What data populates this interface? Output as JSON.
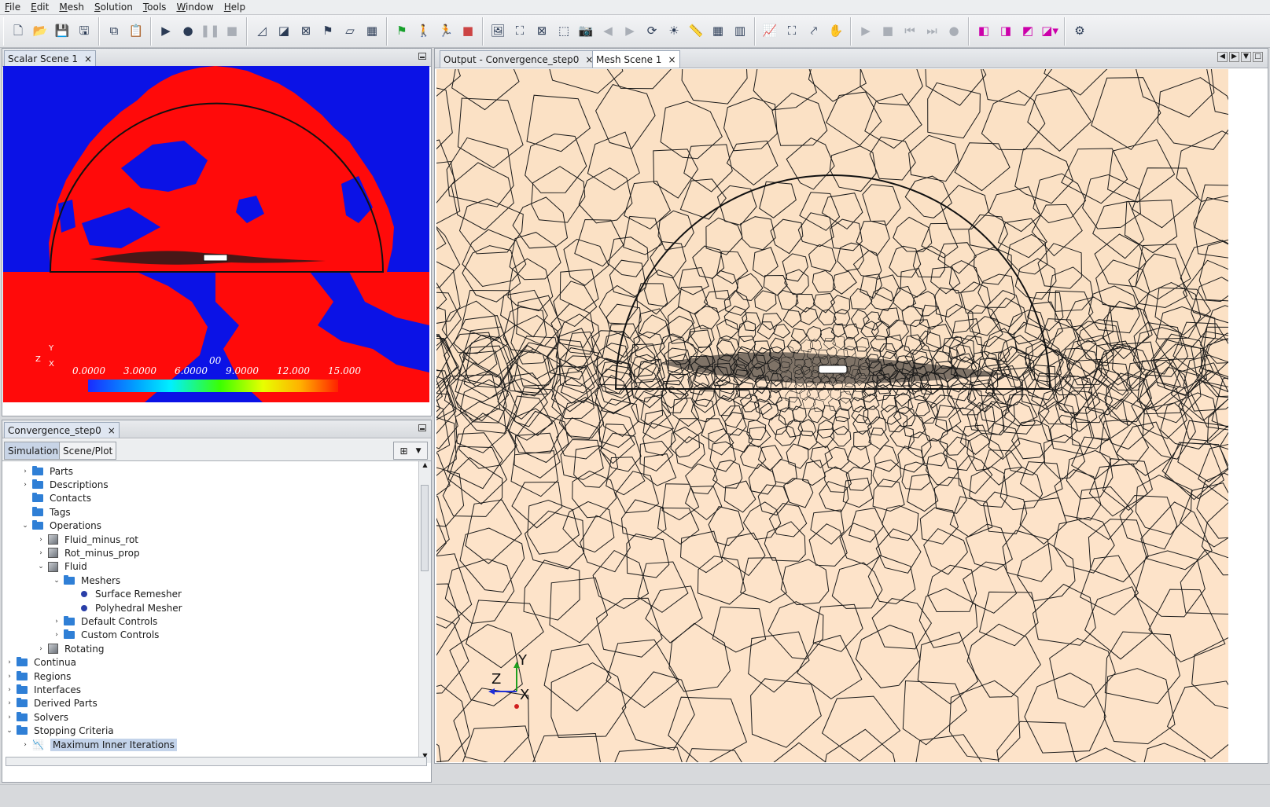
{
  "menu": [
    "File",
    "Edit",
    "Mesh",
    "Solution",
    "Tools",
    "Window",
    "Help"
  ],
  "scalar_panel": {
    "tab_label": "Scalar Scene 1",
    "close": "×"
  },
  "colorbar": {
    "unit_label": "00",
    "ticks": [
      "0.0000",
      "3.0000",
      "6.0000",
      "9.0000",
      "12.000",
      "15.000"
    ]
  },
  "scalar_axes": {
    "y": "Y",
    "z": "Z",
    "x": "X"
  },
  "sim_panel": {
    "tab_label": "Convergence_step0",
    "close": "×",
    "subtabs": [
      "Simulation",
      "Scene/Plot"
    ]
  },
  "tree": [
    {
      "label": "Parts",
      "icon": "folder",
      "depth": 1
    },
    {
      "label": "Descriptions",
      "icon": "folder",
      "depth": 1
    },
    {
      "label": "Contacts",
      "icon": "folder",
      "depth": 1
    },
    {
      "label": "Tags",
      "icon": "folder",
      "depth": 1
    },
    {
      "label": "Operations",
      "icon": "folder",
      "depth": 1
    },
    {
      "label": "Fluid_minus_rot",
      "icon": "cube",
      "depth": 2
    },
    {
      "label": "Rot_minus_prop",
      "icon": "cube",
      "depth": 2
    },
    {
      "label": "Fluid",
      "icon": "cube-warn",
      "depth": 2
    },
    {
      "label": "Meshers",
      "icon": "folder",
      "depth": 3
    },
    {
      "label": "Surface Remesher",
      "icon": "dot",
      "depth": 4
    },
    {
      "label": "Polyhedral Mesher",
      "icon": "dot",
      "depth": 4
    },
    {
      "label": "Default Controls",
      "icon": "folder",
      "depth": 3
    },
    {
      "label": "Custom Controls",
      "icon": "folder",
      "depth": 3
    },
    {
      "label": "Rotating",
      "icon": "cube",
      "depth": 2
    },
    {
      "label": "Continua",
      "icon": "folder",
      "depth": 0
    },
    {
      "label": "Regions",
      "icon": "folder",
      "depth": 0
    },
    {
      "label": "Interfaces",
      "icon": "folder",
      "depth": 0
    },
    {
      "label": "Derived Parts",
      "icon": "folder",
      "depth": 0
    },
    {
      "label": "Solvers",
      "icon": "folder",
      "depth": 0
    },
    {
      "label": "Stopping Criteria",
      "icon": "folder",
      "depth": 0
    },
    {
      "label": "Maximum Inner Iterations",
      "icon": "criteria",
      "depth": 1
    }
  ],
  "main_tabs": [
    "Output - Convergence_step0",
    "Mesh Scene 1"
  ],
  "mesh_axes": {
    "y": "Y",
    "z": "Z",
    "x": "X"
  },
  "colors": {
    "scalar_high": "#ff0a0a",
    "scalar_low": "#0b12e6",
    "mesh_fill": "#fbe1c5",
    "mesh_edge": "#1a1a1a"
  }
}
